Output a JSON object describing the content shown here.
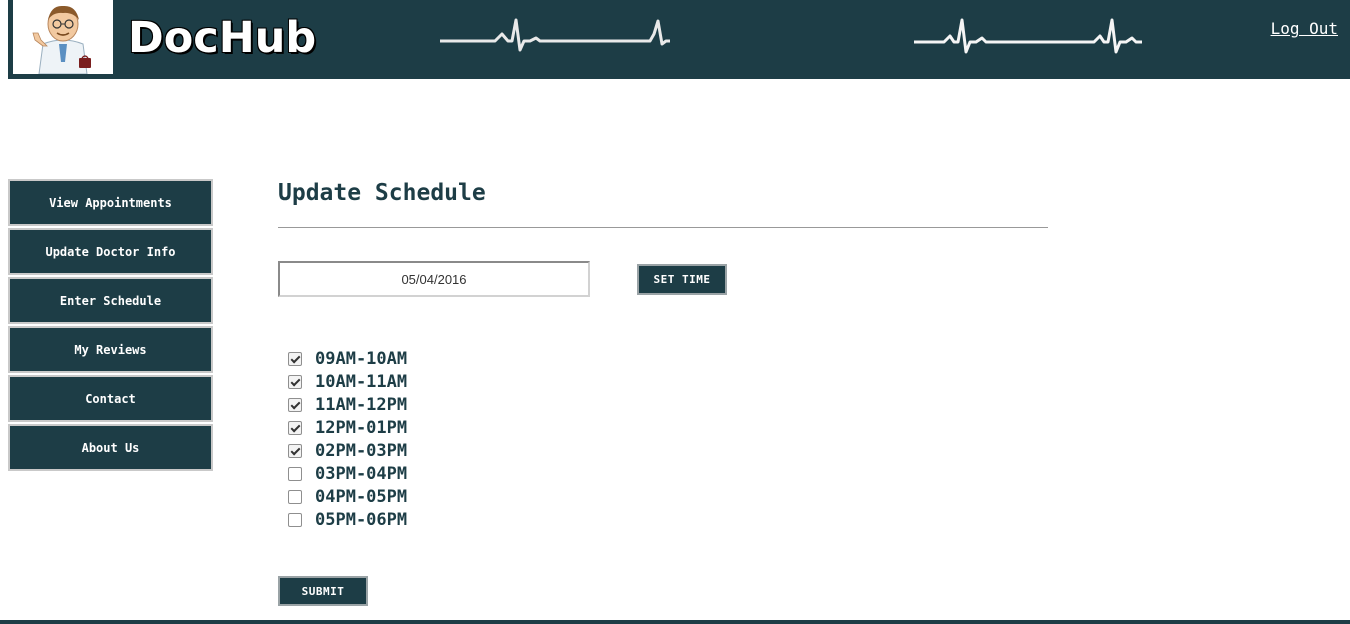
{
  "header": {
    "brand": "DocHub",
    "logout_label": "Log Out",
    "background_color": "#1d3d46"
  },
  "sidebar": {
    "items": [
      {
        "label": "View Appointments"
      },
      {
        "label": "Update Doctor Info"
      },
      {
        "label": "Enter Schedule"
      },
      {
        "label": "My Reviews"
      },
      {
        "label": "Contact"
      },
      {
        "label": "About Us"
      }
    ]
  },
  "main": {
    "title": "Update Schedule",
    "date_value": "05/04/2016",
    "set_time_label": "SET TIME",
    "submit_label": "SUBMIT",
    "slots": [
      {
        "label": "09AM-10AM",
        "checked": true
      },
      {
        "label": "10AM-11AM",
        "checked": true
      },
      {
        "label": "11AM-12PM",
        "checked": true
      },
      {
        "label": "12PM-01PM",
        "checked": true
      },
      {
        "label": "02PM-03PM",
        "checked": true
      },
      {
        "label": "03PM-04PM",
        "checked": false
      },
      {
        "label": "04PM-05PM",
        "checked": false
      },
      {
        "label": "05PM-06PM",
        "checked": false
      }
    ]
  },
  "icons": {
    "logo": "doctor-cartoon-icon",
    "ecg": "heartbeat-line-icon"
  }
}
